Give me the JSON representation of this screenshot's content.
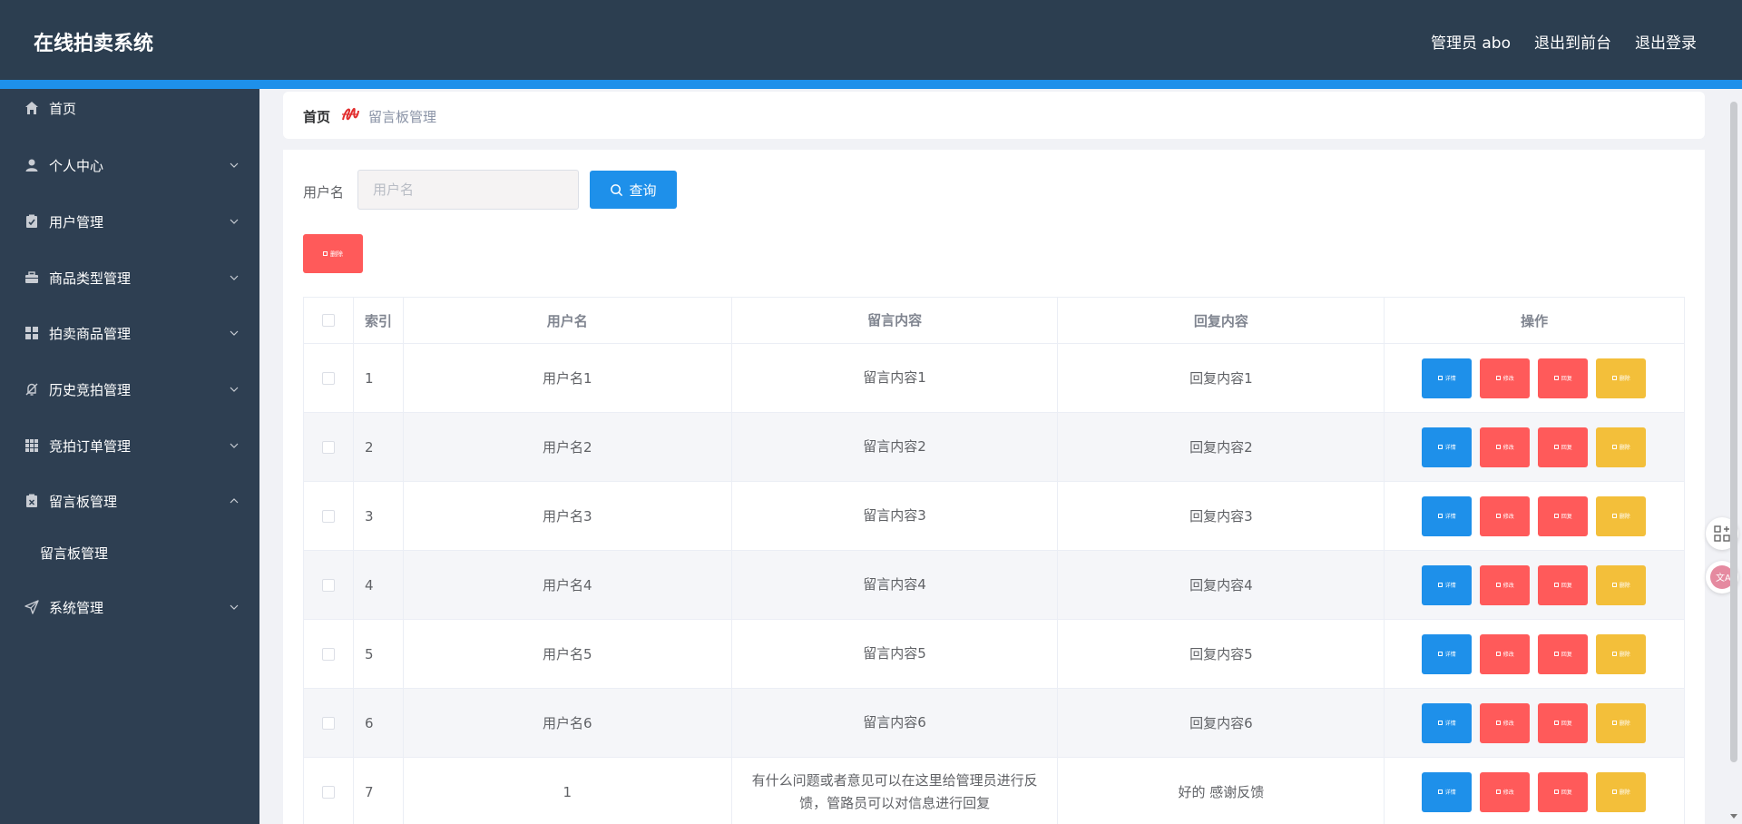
{
  "app": {
    "title": "在线拍卖系统",
    "nav": [
      "管理员 abo",
      "退出到前台",
      "退出登录"
    ]
  },
  "colors": {
    "header_bg": "#2c3e50",
    "accent": "#1e90ea",
    "sidebar_bg": "#2e3f52",
    "danger": "#ff5a5a",
    "warning": "#f3bf3a"
  },
  "sidebar": {
    "items": [
      {
        "label": "首页",
        "icon": "home-icon",
        "expandable": false
      },
      {
        "label": "个人中心",
        "icon": "user-icon",
        "expandable": true
      },
      {
        "label": "用户管理",
        "icon": "clipboard-icon",
        "expandable": true
      },
      {
        "label": "商品类型管理",
        "icon": "briefcase-icon",
        "expandable": true
      },
      {
        "label": "拍卖商品管理",
        "icon": "grid-icon",
        "expandable": true
      },
      {
        "label": "历史竞拍管理",
        "icon": "bell-off-icon",
        "expandable": true
      },
      {
        "label": "竞拍订单管理",
        "icon": "apps-icon",
        "expandable": true
      },
      {
        "label": "留言板管理",
        "icon": "clipboard-x-icon",
        "expandable": true,
        "expanded": true
      },
      {
        "label": "系统管理",
        "icon": "send-icon",
        "expandable": true
      }
    ],
    "submenu": {
      "label": "留言板管理"
    }
  },
  "breadcrumb": {
    "home": "首页",
    "separator_icon": "flourish-icon",
    "current": "留言板管理"
  },
  "search": {
    "label": "用户名",
    "placeholder": "用户名",
    "value": "",
    "button_label": "查询"
  },
  "toolbar": {
    "delete_label": "删除"
  },
  "table": {
    "columns": [
      "",
      "索引",
      "用户名",
      "留言内容",
      "回复内容",
      "操作"
    ],
    "rows": [
      {
        "index": "1",
        "user": "用户名1",
        "message": "留言内容1",
        "reply": "回复内容1"
      },
      {
        "index": "2",
        "user": "用户名2",
        "message": "留言内容2",
        "reply": "回复内容2"
      },
      {
        "index": "3",
        "user": "用户名3",
        "message": "留言内容3",
        "reply": "回复内容3"
      },
      {
        "index": "4",
        "user": "用户名4",
        "message": "留言内容4",
        "reply": "回复内容4"
      },
      {
        "index": "5",
        "user": "用户名5",
        "message": "留言内容5",
        "reply": "回复内容5"
      },
      {
        "index": "6",
        "user": "用户名6",
        "message": "留言内容6",
        "reply": "回复内容6"
      },
      {
        "index": "7",
        "user": "1",
        "message": "有什么问题或者意见可以在这里给管理员进行反馈，管路员可以对信息进行回复",
        "reply": "好的 感谢反馈"
      }
    ],
    "actions": {
      "detail": "详情",
      "edit": "修改",
      "reply": "回复",
      "delete": "删除"
    }
  }
}
